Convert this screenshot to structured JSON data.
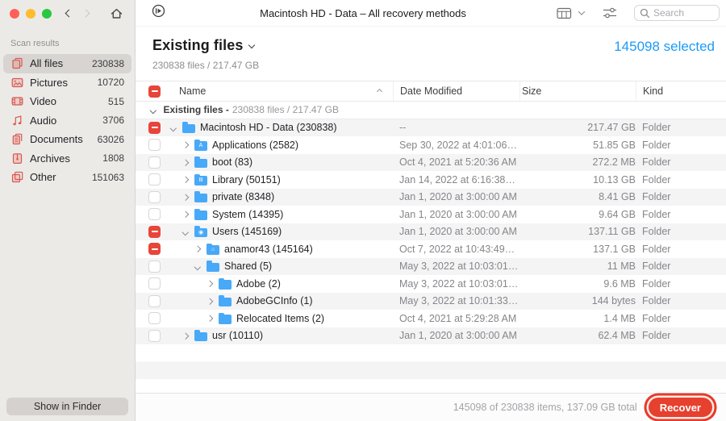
{
  "colors": {
    "accent_blue": "#1d9bf6",
    "checkbox_red": "#e8453a",
    "recover_red": "#e6402f",
    "folder_blue": "#48a9f8",
    "sidebar_icon_red": "#d9574f"
  },
  "titlebar": {
    "title": "Macintosh HD - Data – All recovery methods",
    "search_placeholder": "Search"
  },
  "sidebar": {
    "section_label": "Scan results",
    "items": [
      {
        "label": "All files",
        "count": "230838",
        "icon": "all-files",
        "selected": true
      },
      {
        "label": "Pictures",
        "count": "10720",
        "icon": "pictures",
        "selected": false
      },
      {
        "label": "Video",
        "count": "515",
        "icon": "video",
        "selected": false
      },
      {
        "label": "Audio",
        "count": "3706",
        "icon": "audio",
        "selected": false
      },
      {
        "label": "Documents",
        "count": "63026",
        "icon": "documents",
        "selected": false
      },
      {
        "label": "Archives",
        "count": "1808",
        "icon": "archives",
        "selected": false
      },
      {
        "label": "Other",
        "count": "151063",
        "icon": "other",
        "selected": false
      }
    ],
    "show_in_finder_label": "Show in Finder"
  },
  "header": {
    "title": "Existing files",
    "subtitle": "230838 files / 217.47 GB",
    "selected_label": "145098 selected"
  },
  "table": {
    "columns": [
      "Name",
      "Date Modified",
      "Size",
      "Kind"
    ],
    "group_row": {
      "strong": "Existing files -",
      "rest": "230838 files / 217.47 GB"
    },
    "rows": [
      {
        "name": "Macintosh HD - Data (230838)",
        "level": 0,
        "expand": "down",
        "check": "mixed",
        "badge": "",
        "date": "--",
        "size": "217.47 GB",
        "kind": "Folder"
      },
      {
        "name": "Applications (2582)",
        "level": 1,
        "expand": "right",
        "check": "off",
        "badge": "A",
        "date": "Sep 30, 2022 at 4:01:06…",
        "size": "51.85 GB",
        "kind": "Folder"
      },
      {
        "name": "boot (83)",
        "level": 1,
        "expand": "right",
        "check": "off",
        "badge": "",
        "date": "Oct 4, 2021 at 5:20:36 AM",
        "size": "272.2 MB",
        "kind": "Folder"
      },
      {
        "name": "Library (50151)",
        "level": 1,
        "expand": "right",
        "check": "off",
        "badge": "Ⅲ",
        "date": "Jan 14, 2022 at 6:16:38…",
        "size": "10.13 GB",
        "kind": "Folder"
      },
      {
        "name": "private (8348)",
        "level": 1,
        "expand": "right",
        "check": "off",
        "badge": "",
        "date": "Jan 1, 2020 at 3:00:00 AM",
        "size": "8.41 GB",
        "kind": "Folder"
      },
      {
        "name": "System (14395)",
        "level": 1,
        "expand": "right",
        "check": "off",
        "badge": "",
        "date": "Jan 1, 2020 at 3:00:00 AM",
        "size": "9.64 GB",
        "kind": "Folder"
      },
      {
        "name": "Users (145169)",
        "level": 1,
        "expand": "down",
        "check": "mixed",
        "badge": "◉",
        "date": "Jan 1, 2020 at 3:00:00 AM",
        "size": "137.11 GB",
        "kind": "Folder"
      },
      {
        "name": "anamor43 (145164)",
        "level": 2,
        "expand": "right",
        "check": "mixed",
        "badge": "⌂",
        "date": "Oct 7, 2022 at 10:43:49…",
        "size": "137.1 GB",
        "kind": "Folder"
      },
      {
        "name": "Shared (5)",
        "level": 2,
        "expand": "down",
        "check": "off",
        "badge": "",
        "date": "May 3, 2022 at 10:03:01…",
        "size": "11 MB",
        "kind": "Folder"
      },
      {
        "name": "Adobe (2)",
        "level": 3,
        "expand": "right",
        "check": "off",
        "badge": "",
        "date": "May 3, 2022 at 10:03:01…",
        "size": "9.6 MB",
        "kind": "Folder"
      },
      {
        "name": "AdobeGCInfo (1)",
        "level": 3,
        "expand": "right",
        "check": "off",
        "badge": "",
        "date": "May 3, 2022 at 10:01:33…",
        "size": "144 bytes",
        "kind": "Folder"
      },
      {
        "name": "Relocated Items (2)",
        "level": 3,
        "expand": "right",
        "check": "off",
        "badge": "",
        "date": "Oct 4, 2021 at 5:29:28 AM",
        "size": "1.4 MB",
        "kind": "Folder"
      },
      {
        "name": "usr (10110)",
        "level": 1,
        "expand": "right",
        "check": "off",
        "badge": "",
        "date": "Jan 1, 2020 at 3:00:00 AM",
        "size": "62.4 MB",
        "kind": "Folder"
      }
    ]
  },
  "footer": {
    "status": "145098 of 230838 items, 137.09 GB total",
    "recover_label": "Recover"
  }
}
